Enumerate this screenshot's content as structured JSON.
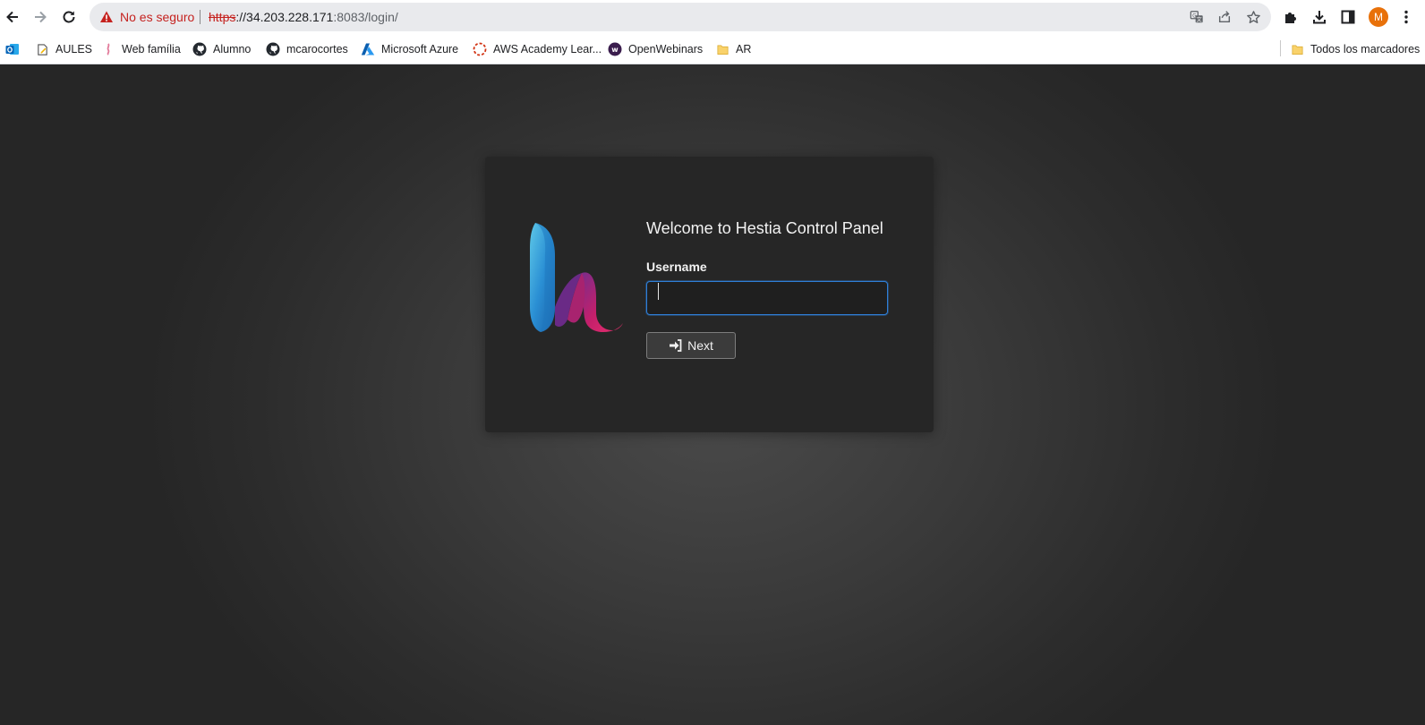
{
  "browser": {
    "address_bar": {
      "security_label": "No es seguro",
      "url_scheme": "https",
      "url_host": "://34.203.228.171",
      "url_rest": ":8083/login/"
    },
    "profile_initial": "M",
    "bookmarks": [
      {
        "label": "",
        "icon": "outlook-icon"
      },
      {
        "label": "AULES",
        "icon": "page-edit-icon"
      },
      {
        "label": "Web família",
        "icon": "web-familia-icon"
      },
      {
        "label": "Alumno",
        "icon": "github-icon"
      },
      {
        "label": "mcarocortes",
        "icon": "github-icon"
      },
      {
        "label": "Microsoft Azure",
        "icon": "azure-icon"
      },
      {
        "label": "AWS Academy Lear...",
        "icon": "aws-academy-icon"
      },
      {
        "label": "OpenWebinars",
        "icon": "openwebinars-icon"
      },
      {
        "label": "AR",
        "icon": "folder-icon"
      }
    ],
    "all_bookmarks_label": "Todos los marcadores"
  },
  "login": {
    "title": "Welcome to Hestia Control Panel",
    "username_label": "Username",
    "username_value": "",
    "next_label": "Next"
  },
  "colors": {
    "card_bg": "#262626",
    "input_focus": "#2f7fd8",
    "logo_blue": "#2a8fd4",
    "logo_pink": "#e0246a",
    "warning_red": "#c5221f"
  }
}
